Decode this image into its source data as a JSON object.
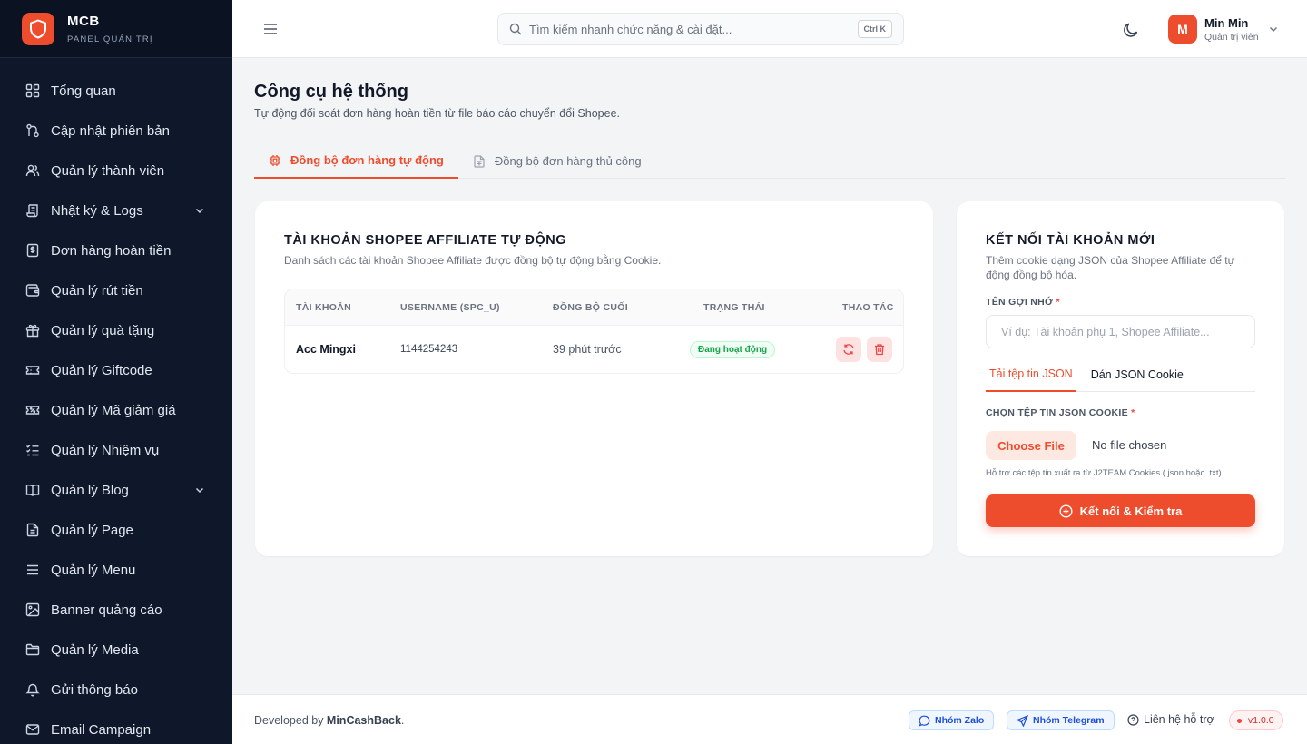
{
  "brand": {
    "name": "MCB",
    "subtitle": "PANEL QUẢN TRỊ"
  },
  "sidebar": {
    "items": [
      {
        "label": "Tổng quan",
        "icon": "grid-icon"
      },
      {
        "label": "Cập nhật phiên bản",
        "icon": "git-branch-icon"
      },
      {
        "label": "Quản lý thành viên",
        "icon": "users-icon"
      },
      {
        "label": "Nhật ký & Logs",
        "icon": "scroll-icon",
        "expandable": true
      },
      {
        "label": "Đơn hàng hoàn tiền",
        "icon": "dollar-receipt-icon"
      },
      {
        "label": "Quản lý rút tiền",
        "icon": "wallet-icon"
      },
      {
        "label": "Quản lý quà tặng",
        "icon": "gift-icon"
      },
      {
        "label": "Quản lý Giftcode",
        "icon": "ticket-icon"
      },
      {
        "label": "Quản lý Mã giảm giá",
        "icon": "coupon-icon"
      },
      {
        "label": "Quản lý Nhiệm vụ",
        "icon": "checklist-icon"
      },
      {
        "label": "Quản lý Blog",
        "icon": "book-icon",
        "expandable": true
      },
      {
        "label": "Quản lý Page",
        "icon": "file-icon"
      },
      {
        "label": "Quản lý Menu",
        "icon": "menu-icon"
      },
      {
        "label": "Banner quảng cáo",
        "icon": "image-icon"
      },
      {
        "label": "Quản lý Media",
        "icon": "folder-icon"
      },
      {
        "label": "Gửi thông báo",
        "icon": "bell-icon"
      },
      {
        "label": "Email Campaign",
        "icon": "mail-icon"
      }
    ]
  },
  "header": {
    "search_placeholder": "Tìm kiếm nhanh chức năng & cài đặt...",
    "search_shortcut": "Ctrl K",
    "user": {
      "initial": "M",
      "name": "Min Min",
      "role": "Quản trị viên"
    }
  },
  "page": {
    "title": "Công cụ hệ thống",
    "subtitle": "Tự động đối soát đơn hàng hoàn tiền từ file báo cáo chuyển đổi Shopee.",
    "tabs": [
      {
        "label": "Đồng bộ đơn hàng tự động",
        "active": true
      },
      {
        "label": "Đồng bộ đơn hàng thủ công",
        "active": false
      }
    ]
  },
  "accounts_card": {
    "title": "TÀI KHOẢN SHOPEE AFFILIATE TỰ ĐỘNG",
    "description": "Danh sách các tài khoản Shopee Affiliate được đồng bộ tự động bằng Cookie.",
    "columns": [
      "TÀI KHOẢN",
      "USERNAME (SPC_U)",
      "ĐỒNG BỘ CUỐI",
      "TRẠNG THÁI",
      "THAO TÁC"
    ],
    "rows": [
      {
        "account": "Acc Mingxi",
        "username": "1144254243",
        "last_sync": "39 phút trước",
        "status": "Đang hoạt động"
      }
    ]
  },
  "connect_card": {
    "title": "KẾT NỐI TÀI KHOẢN MỚI",
    "description_line1": "Thêm cookie dạng JSON của Shopee Affiliate để tự",
    "description_line2": "động đồng bộ hóa.",
    "name_label": "TÊN GỢI NHỚ",
    "required_mark": "*",
    "name_placeholder": "Ví dụ: Tài khoản phụ 1, Shopee Affiliate...",
    "subtabs": [
      {
        "label": "Tải tệp tin JSON",
        "active": true
      },
      {
        "label": "Dán JSON Cookie",
        "active": false
      }
    ],
    "file_label": "CHỌN TỆP TIN JSON COOKIE",
    "file_button": "Choose File",
    "file_status": "No file chosen",
    "file_hint": "Hỗ trợ các tệp tin xuất ra từ J2TEAM Cookies (.json hoặc .txt)",
    "submit_label": "Kết nối & Kiểm tra"
  },
  "footer": {
    "developed_prefix": "Developed by ",
    "developer": "MinCashBack",
    "developed_suffix": ".",
    "zalo_label": "Nhóm Zalo",
    "telegram_label": "Nhóm Telegram",
    "support_label": "Liên hệ hỗ trợ",
    "version": "v1.0.0"
  },
  "colors": {
    "accent": "#ee4d2d",
    "sidebar_bg": "#0f172a",
    "success": "#16a34a"
  }
}
